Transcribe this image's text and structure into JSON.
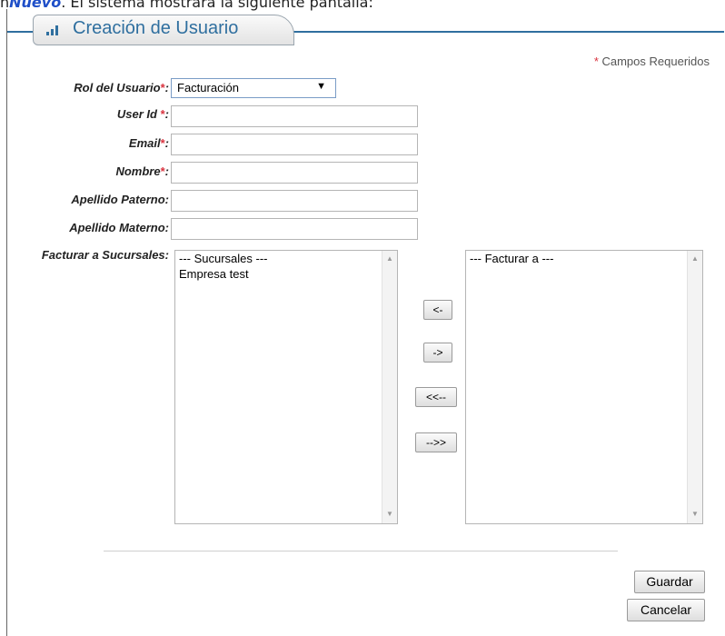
{
  "intro": {
    "prefix": "n",
    "link": "Nuevo",
    "text": ". El sistema mostrará la siguiente pantalla:"
  },
  "header": {
    "title": "Creación de Usuario"
  },
  "required_note": {
    "star": "*",
    "text": " Campos Requeridos"
  },
  "form": {
    "rol": {
      "label": "Rol del Usuario",
      "star": "*",
      "colon": ":",
      "value": "Facturación"
    },
    "user_id": {
      "label": "User Id ",
      "star": "*",
      "colon": ":"
    },
    "email": {
      "label": "Email",
      "star": "*",
      "colon": ":"
    },
    "nombre": {
      "label": "Nombre",
      "star": "*",
      "colon": ":"
    },
    "apellido_paterno": {
      "label": "Apellido Paterno:"
    },
    "apellido_materno": {
      "label": "Apellido Materno:"
    },
    "sucursales": {
      "label": "Facturar a Sucursales:"
    }
  },
  "left_list": {
    "items": [
      "--- Sucursales ---",
      "Empresa test"
    ]
  },
  "right_list": {
    "items": [
      "--- Facturar a ---"
    ]
  },
  "transfer_buttons": {
    "left_one": "<-",
    "right_one": "->",
    "left_all": "<<--",
    "right_all": "-->>"
  },
  "actions": {
    "save": "Guardar",
    "cancel": "Cancelar"
  },
  "colors": {
    "accent": "#2f6f9f",
    "required": "#d9333f"
  }
}
